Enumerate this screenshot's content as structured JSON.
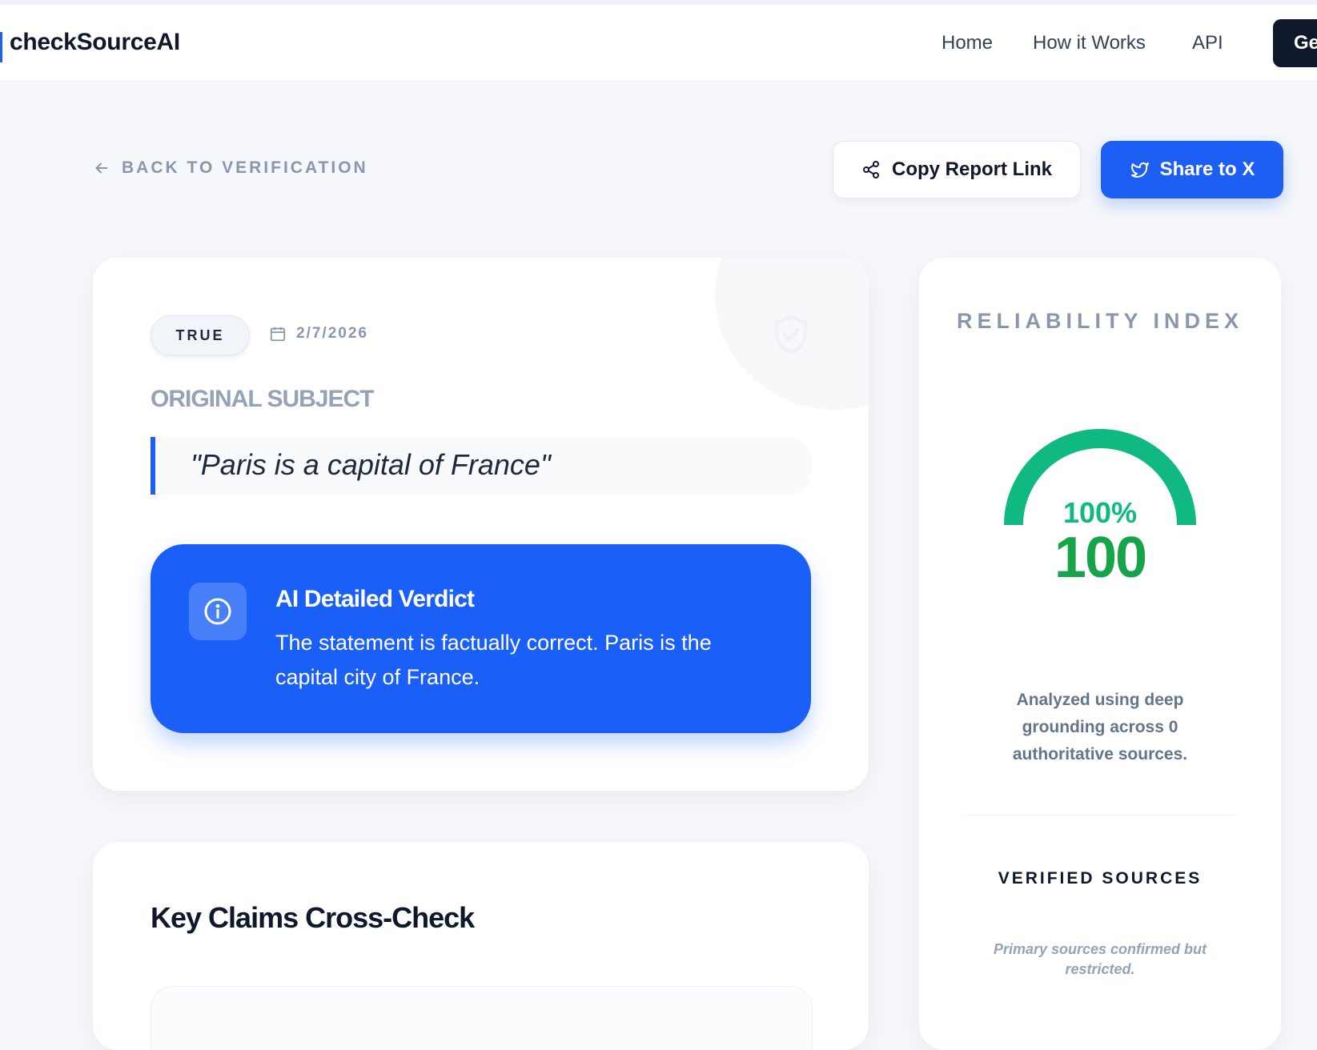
{
  "navbar": {
    "brand": "checkSourceAI",
    "links": [
      "Home",
      "How it Works",
      "API"
    ],
    "cta_label": "Ge"
  },
  "toolbar": {
    "back_label": "BACK TO VERIFICATION",
    "copy_label": "Copy Report Link",
    "share_label": "Share to X"
  },
  "report": {
    "status": "TRUE",
    "date": "2/7/2026",
    "original_label": "ORIGINAL SUBJECT",
    "quote": "\"Paris is a capital of France\"",
    "verdict_title": "AI Detailed Verdict",
    "verdict_text": "The statement is factually correct. Paris is the capital city of France."
  },
  "claims": {
    "title": "Key Claims Cross-Check"
  },
  "reliability": {
    "title": "RELIABILITY INDEX",
    "percent_label": "100%",
    "score": "100",
    "score_fraction": 1.0,
    "analyzed_text": "Analyzed using deep grounding across 0 authoritative sources.",
    "verified_title": "VERIFIED SOURCES",
    "restricted_text": "Primary sources confirmed but restricted."
  },
  "colors": {
    "accent": "#1d5ff5",
    "gauge": "#10b981",
    "score": "#16a34a",
    "dark": "#0f172a"
  },
  "icons": [
    "arrow-left-icon",
    "share-icon",
    "twitter-bird-icon",
    "calendar-icon",
    "shield-check-icon",
    "info-icon"
  ]
}
